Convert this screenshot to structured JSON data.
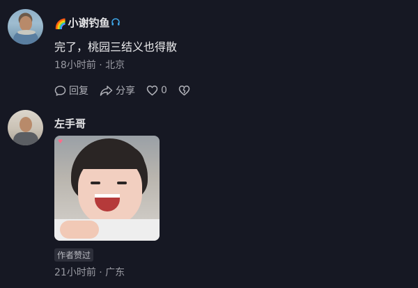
{
  "comments": [
    {
      "username": "小谢钓鱼",
      "username_prefix_emoji": "🌈",
      "username_suffix_icon": "headphones-icon",
      "text": "完了，桃园三结义也得散",
      "meta": "18小时前 · 北京",
      "actions": {
        "reply_label": "回复",
        "share_label": "分享",
        "like_count": "0"
      }
    },
    {
      "username": "左手哥",
      "badge": "作者赞过",
      "meta": "21小时前 · 广东"
    }
  ],
  "colors": {
    "background": "#161823",
    "text_primary": "#ececee",
    "text_secondary": "#9a9ba3",
    "badge_bg": "#2d2f3a"
  }
}
